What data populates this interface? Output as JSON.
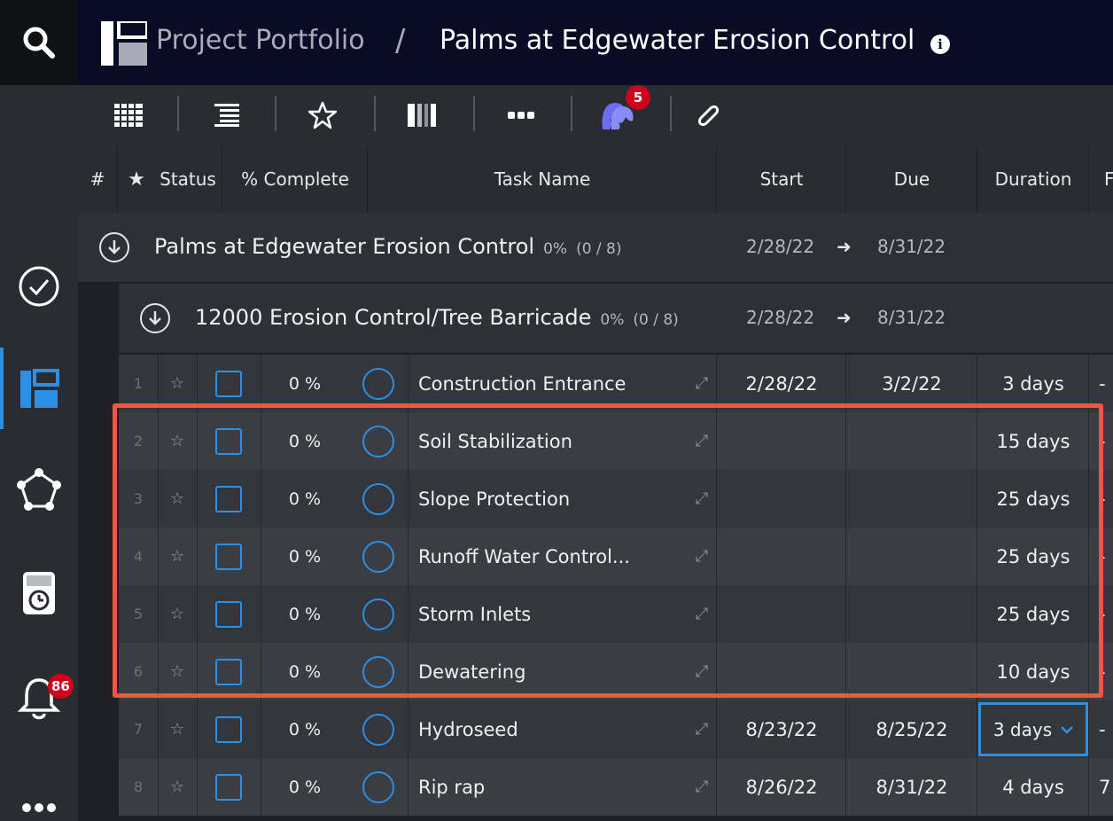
{
  "rail": {
    "notifications_badge": "86"
  },
  "header": {
    "breadcrumb_portfolio": "Project Portfolio",
    "breadcrumb_separator": "/",
    "project_title": "Palms at Edgewater Erosion Control",
    "info": "i"
  },
  "toolbar": {
    "people_badge": "5",
    "more": "•••"
  },
  "columns": {
    "num": "#",
    "star": "★",
    "status": "Status",
    "pct_complete": "% Complete",
    "task_name": "Task Name",
    "start": "Start",
    "due": "Due",
    "duration": "Duration",
    "next": "F"
  },
  "groups": [
    {
      "name": "Palms at Edgewater Erosion Control",
      "pct": "0%",
      "count": "(0 / 8)",
      "start": "2/28/22",
      "due": "8/31/22"
    },
    {
      "name": "12000 Erosion Control/Tree Barricade",
      "pct": "0%",
      "count": "(0 / 8)",
      "start": "2/28/22",
      "due": "8/31/22"
    }
  ],
  "tasks": [
    {
      "num": "1",
      "pct": "0 %",
      "name": "Construction Entrance",
      "start": "2/28/22",
      "due": "3/2/22",
      "duration": "3 days",
      "extra": "-"
    },
    {
      "num": "2",
      "pct": "0 %",
      "name": "Soil Stabilization",
      "start": "",
      "due": "",
      "duration": "15 days",
      "extra": "-"
    },
    {
      "num": "3",
      "pct": "0 %",
      "name": "Slope Protection",
      "start": "",
      "due": "",
      "duration": "25 days",
      "extra": "-"
    },
    {
      "num": "4",
      "pct": "0 %",
      "name": "Runoff Water Control...",
      "start": "",
      "due": "",
      "duration": "25 days",
      "extra": "-"
    },
    {
      "num": "5",
      "pct": "0 %",
      "name": "Storm Inlets",
      "start": "",
      "due": "",
      "duration": "25 days",
      "extra": "-"
    },
    {
      "num": "6",
      "pct": "0 %",
      "name": "Dewatering",
      "start": "",
      "due": "",
      "duration": "10 days",
      "extra": "-"
    },
    {
      "num": "7",
      "pct": "0 %",
      "name": "Hydroseed",
      "start": "8/23/22",
      "due": "8/25/22",
      "duration": "3 days",
      "extra": "-"
    },
    {
      "num": "8",
      "pct": "0 %",
      "name": "Rip rap",
      "start": "8/26/22",
      "due": "8/31/22",
      "duration": "4 days",
      "extra": "7"
    }
  ],
  "colors": {
    "accent": "#2b8fe3",
    "highlight": "#f05545",
    "badge": "#d0021b",
    "header_bg": "#0a0c25"
  }
}
